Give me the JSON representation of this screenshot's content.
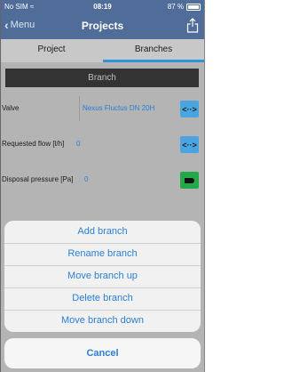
{
  "status_bar": {
    "carrier": "No SIM ≈",
    "time": "08:19",
    "battery": "87 %"
  },
  "nav": {
    "back_label": "Menu",
    "title": "Projects",
    "share_icon": "share-icon"
  },
  "tabs": [
    {
      "label": "Project",
      "active": false
    },
    {
      "label": "Branches",
      "active": true
    }
  ],
  "section": {
    "header": "Branch"
  },
  "rows": [
    {
      "label": "Valve",
      "value": "Nexus Fluctus DN 20H",
      "button": "<··>",
      "button_icon": "exchange-icon"
    },
    {
      "label": "Requested flow [l/h]",
      "value": "0",
      "button": "<··>",
      "button_icon": "exchange-icon"
    },
    {
      "label": "Disposal pressure [Pa]",
      "value": "0",
      "button": "",
      "button_icon": "tag-icon"
    }
  ],
  "action_sheet": {
    "items": [
      "Add branch",
      "Rename branch",
      "Move branch up",
      "Delete branch",
      "Move branch down"
    ],
    "cancel": "Cancel"
  },
  "colors": {
    "nav_bar": "#4f6d98",
    "accent": "#2d96d8",
    "link": "#2a7fd4",
    "button_blue": "#49a4df",
    "button_green": "#23a84a"
  }
}
